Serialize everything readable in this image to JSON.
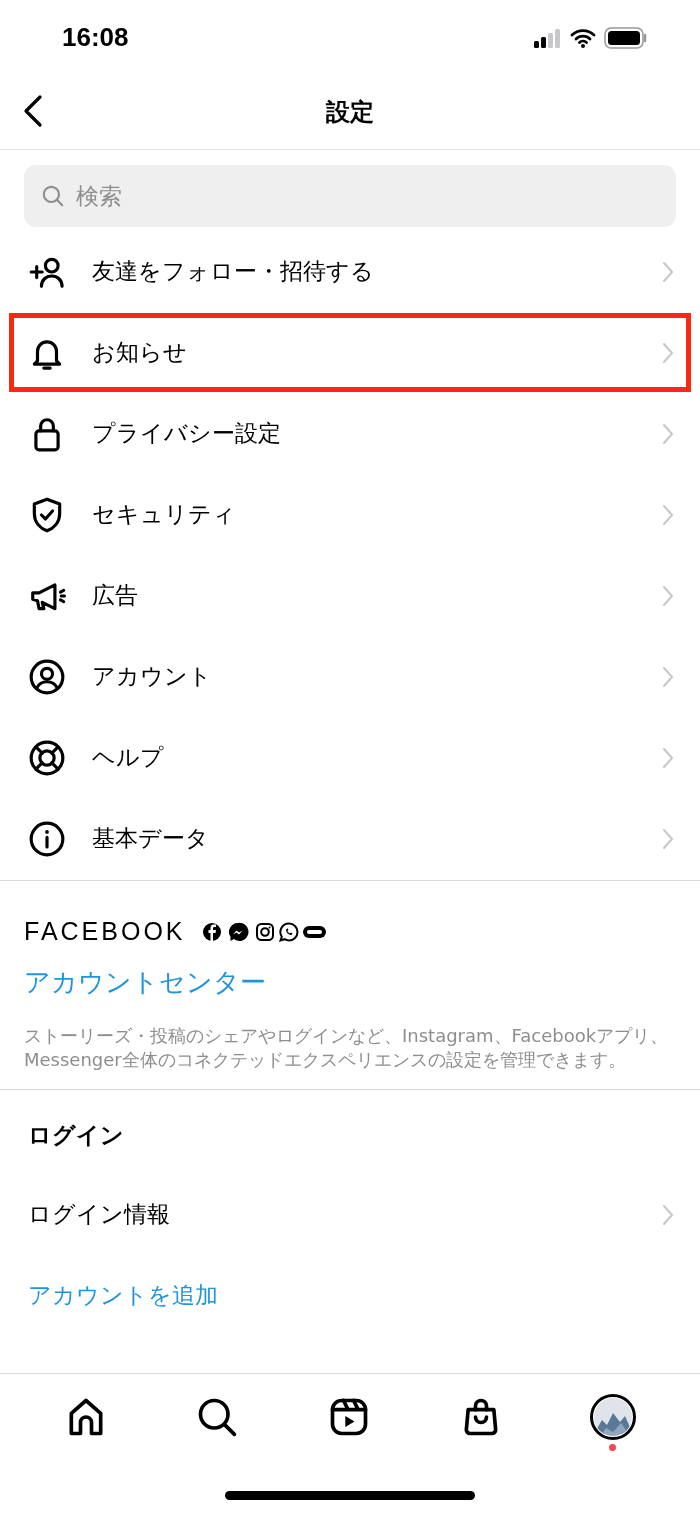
{
  "status_bar": {
    "time": "16:08"
  },
  "header": {
    "title": "設定"
  },
  "search": {
    "placeholder": "検索"
  },
  "menu": [
    {
      "kind": "add-person",
      "label": "友達をフォロー・招待する",
      "highlighted": false
    },
    {
      "kind": "bell",
      "label": "お知らせ",
      "highlighted": true
    },
    {
      "kind": "lock",
      "label": "プライバシー設定",
      "highlighted": false
    },
    {
      "kind": "shield",
      "label": "セキュリティ",
      "highlighted": false
    },
    {
      "kind": "megaphone",
      "label": "広告",
      "highlighted": false
    },
    {
      "kind": "account",
      "label": "アカウント",
      "highlighted": false
    },
    {
      "kind": "help",
      "label": "ヘルプ",
      "highlighted": false
    },
    {
      "kind": "info",
      "label": "基本データ",
      "highlighted": false
    }
  ],
  "facebook": {
    "brand": "FACEBOOK",
    "link": "アカウントセンター",
    "description": "ストーリーズ・投稿のシェアやログインなど、Instagram、Facebookアプリ、Messenger全体のコネクテッドエクスペリエンスの設定を管理できます。"
  },
  "login": {
    "heading": "ログイン",
    "items": [
      {
        "kind": "nav",
        "label": "ログイン情報"
      },
      {
        "kind": "link",
        "label": "アカウントを追加"
      }
    ]
  },
  "tab_bar": [
    {
      "kind": "home",
      "notification_dot": false
    },
    {
      "kind": "search",
      "notification_dot": false
    },
    {
      "kind": "reels",
      "notification_dot": false
    },
    {
      "kind": "shop",
      "notification_dot": false
    },
    {
      "kind": "profile",
      "notification_dot": true
    }
  ]
}
